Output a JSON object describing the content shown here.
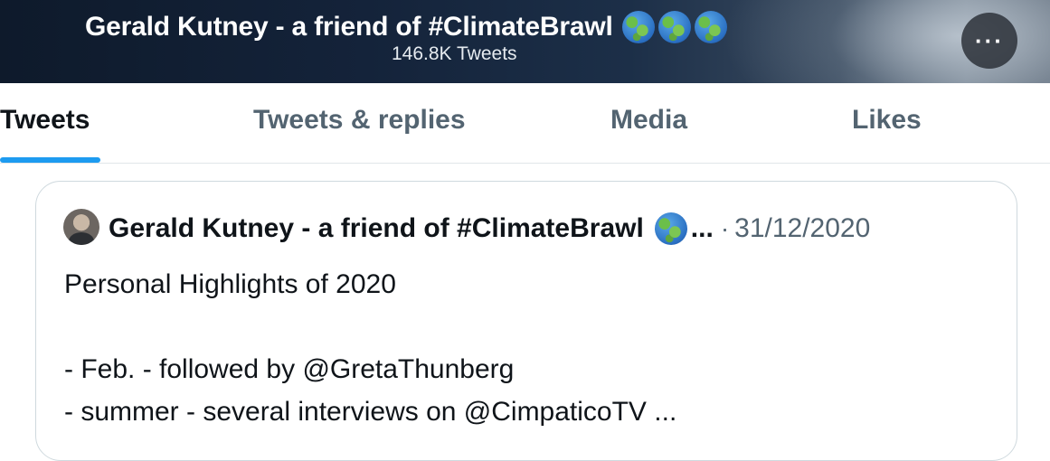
{
  "header": {
    "title": "Gerald Kutney - a friend of #ClimateBrawl",
    "title_emoji": [
      "globe-americas",
      "globe-africa",
      "globe-asia"
    ],
    "tweet_count": "146.8K Tweets",
    "more_label": "···"
  },
  "tabs": [
    {
      "label": "Tweets",
      "active": true
    },
    {
      "label": "Tweets & replies",
      "active": false
    },
    {
      "label": "Media",
      "active": false
    },
    {
      "label": "Likes",
      "active": false
    }
  ],
  "colors": {
    "accent": "#1d9bf0",
    "text_primary": "#0f1419",
    "text_secondary": "#536471",
    "border": "#cfd9de"
  },
  "tweet": {
    "author": "Gerald Kutney - a friend of #ClimateBrawl",
    "author_emoji": "globe-americas",
    "truncation": "...",
    "separator": "·",
    "date": "31/12/2020",
    "text": "Personal Highlights of 2020\n\n- Feb. - followed by @GretaThunberg\n- summer - several interviews on @CimpaticoTV ..."
  }
}
